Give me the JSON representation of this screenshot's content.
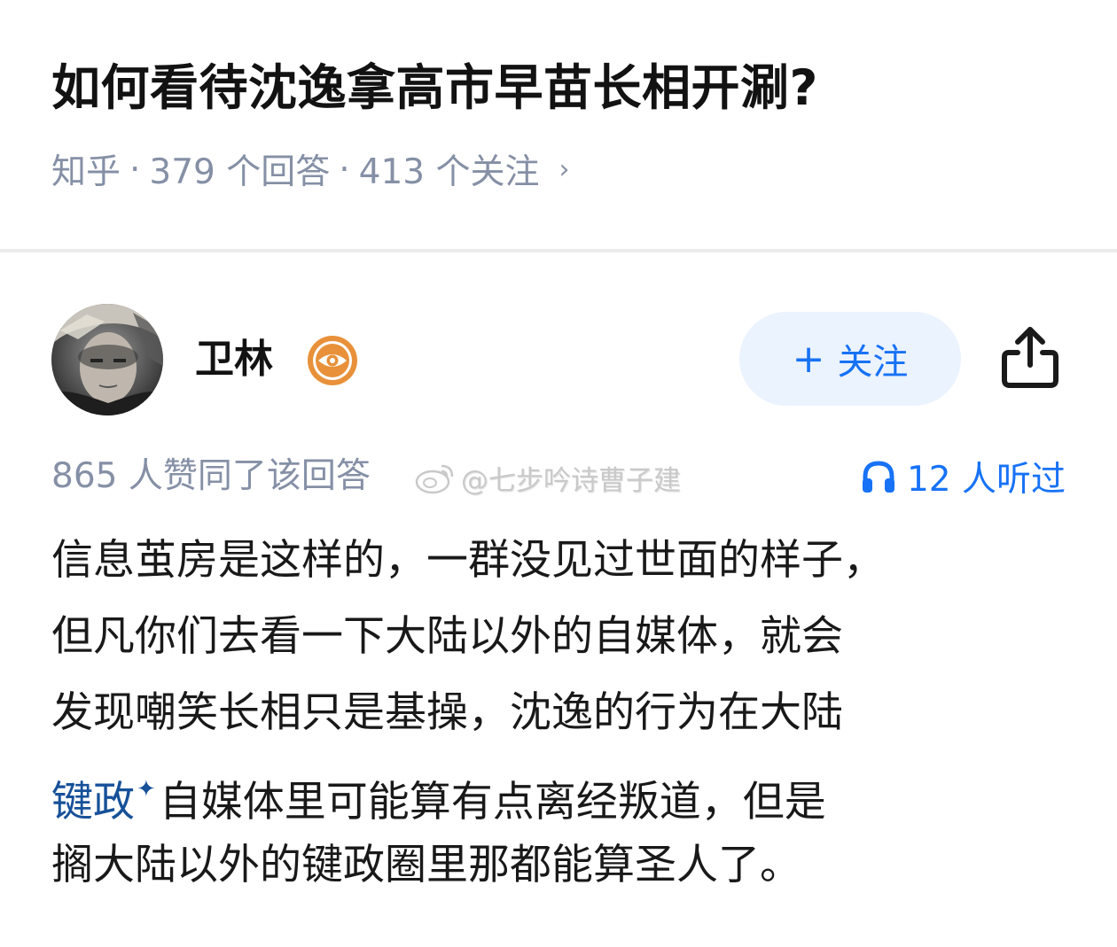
{
  "question": {
    "title": "如何看待沈逸拿高市早苗长相开涮?",
    "source": "知乎",
    "answers": "379 个回答",
    "followers": "413 个关注",
    "separator": "·",
    "chevron": "›"
  },
  "author": {
    "name": "卫林",
    "badge_icon": "eye-badge-icon",
    "avatar": "author-avatar"
  },
  "actions": {
    "follow_plus": "+",
    "follow_label": "关注",
    "share_icon": "share-icon"
  },
  "stats": {
    "votes": "865 人赞同了该回答",
    "watermark": "@七步吟诗曹子建",
    "listen_count": "12 人听过",
    "listen_icon": "headphones-icon"
  },
  "content": {
    "line1": "信息茧房是这样的，一群没见过世面的样子，",
    "line2": "但凡你们去看一下大陆以外的自媒体，就会",
    "line3": "发现嘲笑长相只是基操，沈逸的行为在大陆",
    "line4_keyword": "键政",
    "line4_spark": "✦",
    "line4_rest": "自媒体里可能算有点离经叛道，但是",
    "line5": "搁大陆以外的键政圈里那都能算圣人了。"
  },
  "colors": {
    "accent": "#1772f6",
    "meta_gray": "#8590a6",
    "keyword": "#175199",
    "follow_bg": "#ebf3ff",
    "badge_orange": "#e8913a"
  }
}
